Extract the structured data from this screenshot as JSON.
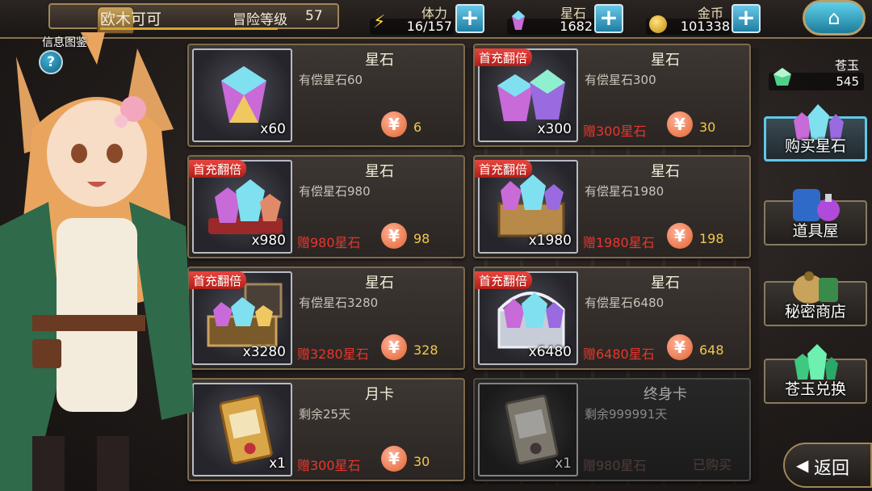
{
  "player": {
    "name": "欧木可可",
    "level_label": "冒险等级",
    "level": "57",
    "info_label": "信息图鉴",
    "help_glyph": "?"
  },
  "resources": [
    {
      "label": "体力",
      "value": "16/157",
      "icon": "lightning-icon"
    },
    {
      "label": "星石",
      "value": "1682",
      "icon": "gem-icon"
    },
    {
      "label": "金币",
      "value": "101338",
      "icon": "coin-icon"
    }
  ],
  "plus_glyph": "+",
  "home_glyph": "⌂",
  "jade": {
    "label": "苍玉",
    "value": "545"
  },
  "cards": [
    {
      "title": "星石",
      "desc": "有偿星石60",
      "qty": "x60",
      "badge": "",
      "bonus": "",
      "price": "6",
      "bought": ""
    },
    {
      "title": "星石",
      "desc": "有偿星石300",
      "qty": "x300",
      "badge": "首充翻倍",
      "bonus": "赠300星石",
      "price": "30",
      "bought": ""
    },
    {
      "title": "星石",
      "desc": "有偿星石980",
      "qty": "x980",
      "badge": "首充翻倍",
      "bonus": "赠980星石",
      "price": "98",
      "bought": ""
    },
    {
      "title": "星石",
      "desc": "有偿星石1980",
      "qty": "x1980",
      "badge": "首充翻倍",
      "bonus": "赠1980星石",
      "price": "198",
      "bought": ""
    },
    {
      "title": "星石",
      "desc": "有偿星石3280",
      "qty": "x3280",
      "badge": "首充翻倍",
      "bonus": "赠3280星石",
      "price": "328",
      "bought": ""
    },
    {
      "title": "星石",
      "desc": "有偿星石6480",
      "qty": "x6480",
      "badge": "首充翻倍",
      "bonus": "赠6480星石",
      "price": "648",
      "bought": ""
    },
    {
      "title": "月卡",
      "desc": "剩余25天",
      "qty": "x1",
      "badge": "",
      "bonus": "赠300星石",
      "price": "30",
      "bought": ""
    },
    {
      "title": "终身卡",
      "desc": "剩余999991天",
      "qty": "x1",
      "badge": "",
      "bonus": "赠980星石",
      "price": "",
      "bought": "已购买"
    }
  ],
  "currency_glyph": "¥",
  "menu": [
    {
      "label": "购买星石",
      "icon": "crystal-cluster-icon"
    },
    {
      "label": "道具屋",
      "icon": "potion-bag-icon"
    },
    {
      "label": "秘密商店",
      "icon": "treasure-bag-icon"
    },
    {
      "label": "苍玉兑换",
      "icon": "green-crystal-icon"
    }
  ],
  "back": {
    "label": "返回",
    "arrow": "◀"
  }
}
